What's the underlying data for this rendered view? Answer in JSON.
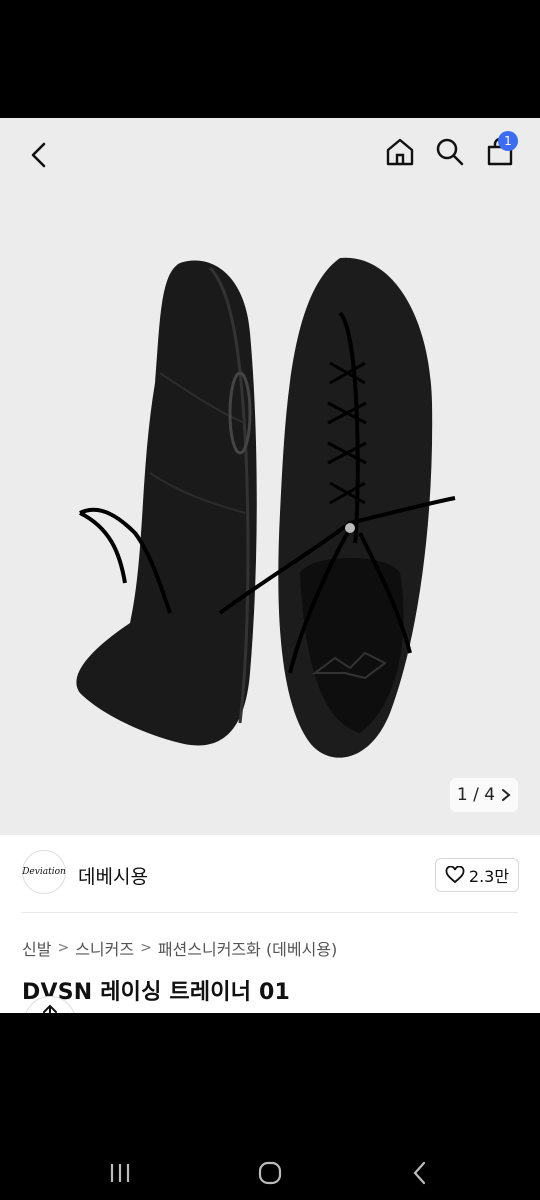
{
  "header": {
    "back_icon": "chevron-left-icon",
    "home_icon": "home-icon",
    "search_icon": "search-icon",
    "cart_icon": "shopping-bag-icon",
    "cart_count": "1",
    "badge_color": "#3b6cf2"
  },
  "gallery": {
    "pager_text": "1 / 4",
    "next_icon": "chevron-right-icon"
  },
  "brand": {
    "logo_text": "Deviation",
    "name": "데베시용",
    "like_count": "2.3만",
    "like_icon": "heart-outline-icon"
  },
  "breadcrumb": [
    "신발",
    "스니커즈",
    "패션스니커즈화 (데베시용)"
  ],
  "product": {
    "title": "DVSN 레이싱 트레이너 01"
  },
  "system_nav": {
    "recent_icon": "recent-apps-icon",
    "home_icon": "home-circle-icon",
    "back_icon": "back-chevron-icon"
  }
}
